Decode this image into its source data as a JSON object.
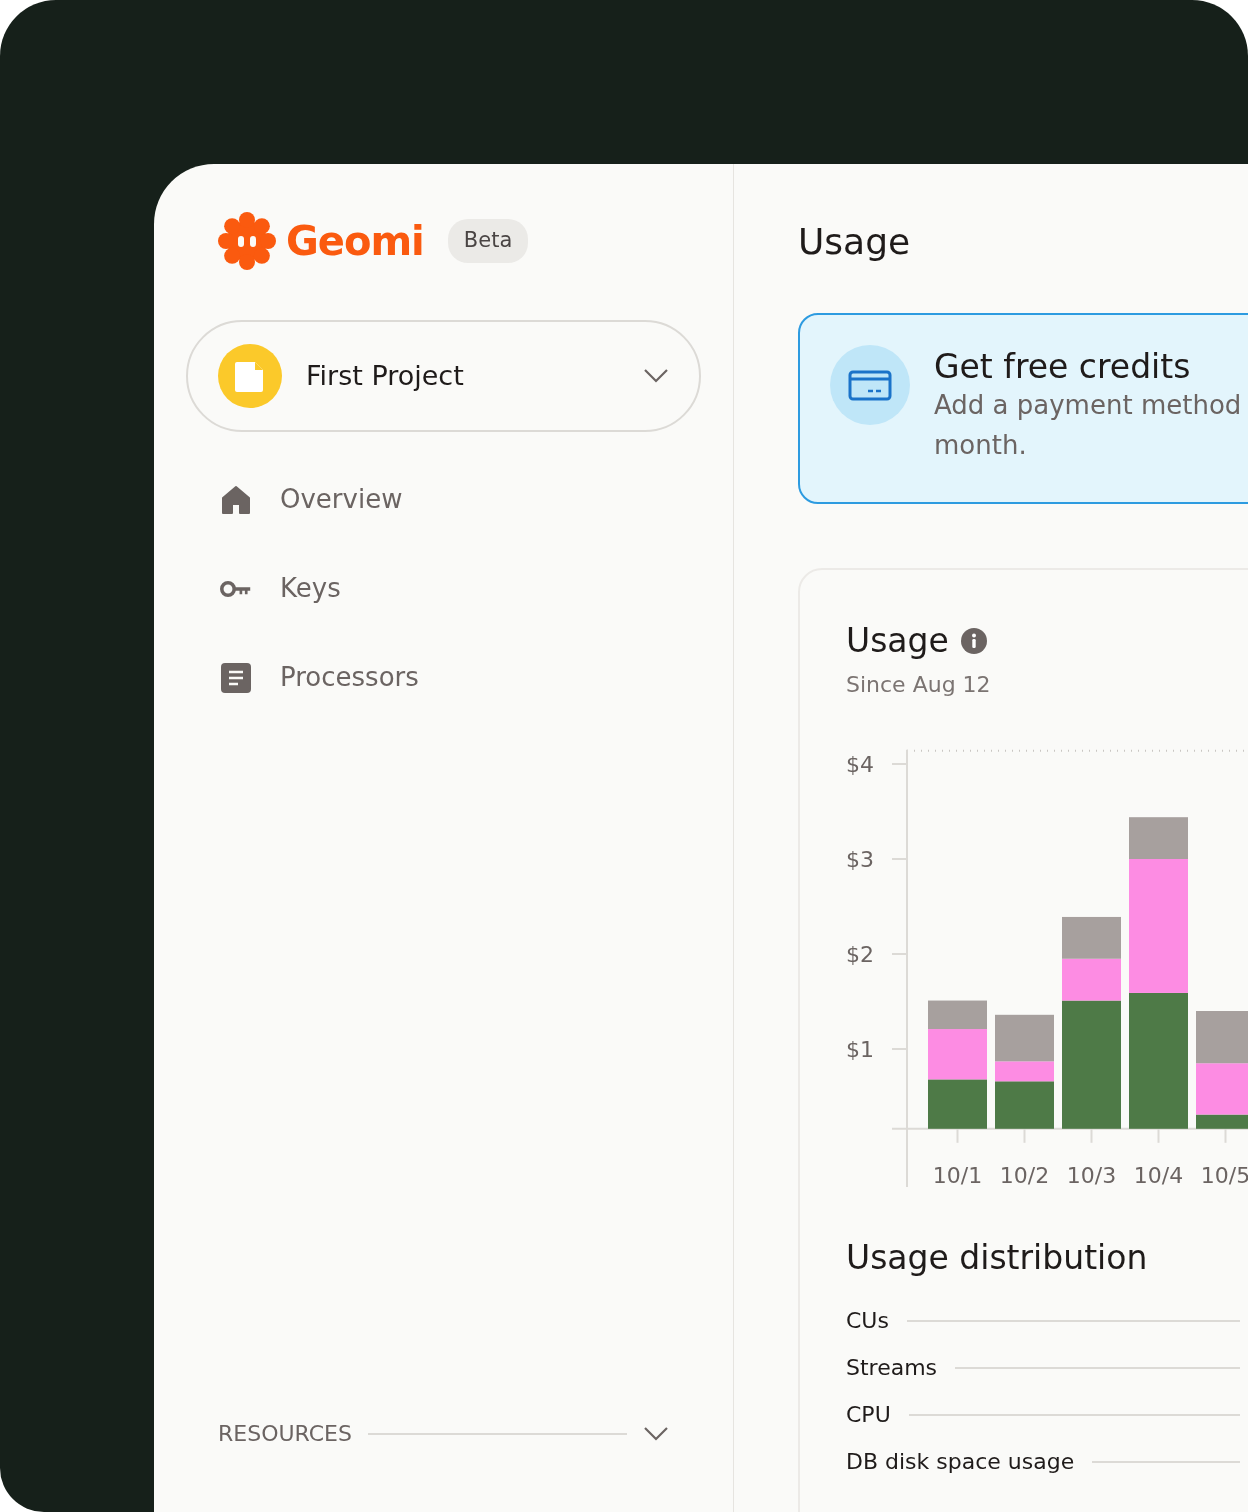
{
  "sidebar": {
    "logo": "Geomi",
    "badge": "Beta",
    "project": {
      "name": "First Project"
    },
    "nav": [
      {
        "label": "Overview"
      },
      {
        "label": "Keys"
      },
      {
        "label": "Processors"
      }
    ],
    "sections": [
      {
        "label": "RESOURCES"
      }
    ]
  },
  "main": {
    "title": "Usage",
    "credits": {
      "title": "Get free credits",
      "description_lines": [
        "Add a payment method",
        "month."
      ]
    },
    "usage_card": {
      "title": "Usage",
      "subtitle": "Since Aug 12",
      "chart_data": {
        "type": "bar",
        "stacked": true,
        "categories": [
          "10/1",
          "10/2",
          "10/3",
          "10/4",
          "10/5"
        ],
        "ylim": [
          0.16,
          4.15
        ],
        "yticks": [
          {
            "value": 1,
            "label": "$1"
          },
          {
            "value": 2,
            "label": "$2"
          },
          {
            "value": 3,
            "label": "$3"
          },
          {
            "value": 4,
            "label": "$4"
          }
        ],
        "series": [
          {
            "color": "#4e7a47",
            "values": [
              0.68,
              0.66,
              1.51,
              1.59,
              0.31
            ]
          },
          {
            "color": "#fd8ce3",
            "values": [
              0.53,
              0.21,
              0.44,
              1.41,
              0.54
            ]
          },
          {
            "color": "#a7a09e",
            "values": [
              0.3,
              0.49,
              0.44,
              0.44,
              0.55
            ]
          }
        ]
      },
      "distribution_title": "Usage distribution",
      "distribution": [
        {
          "label": "CUs"
        },
        {
          "label": "Streams"
        },
        {
          "label": "CPU"
        },
        {
          "label": "DB disk space usage"
        }
      ]
    }
  }
}
